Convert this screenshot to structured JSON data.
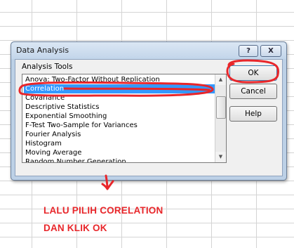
{
  "dialog": {
    "title": "Data Analysis",
    "help_glyph": "?",
    "close_glyph": "X",
    "group_label": "Analysis Tools",
    "tools": [
      "Anova: Two-Factor Without Replication",
      "Correlation",
      "Covariance",
      "Descriptive Statistics",
      "Exponential Smoothing",
      "F-Test Two-Sample for Variances",
      "Fourier Analysis",
      "Histogram",
      "Moving Average",
      "Random Number Generation"
    ],
    "selected_tool": "Correlation",
    "buttons": {
      "ok": "OK",
      "cancel": "Cancel",
      "help": "Help"
    }
  },
  "annotation": {
    "color": "#e8262a",
    "line1": "LALU PILIH CORELATION",
    "line2": "DAN KLIK OK"
  },
  "colors": {
    "selection": "#3399ff",
    "dialog_frame": "#bcd0e6"
  }
}
